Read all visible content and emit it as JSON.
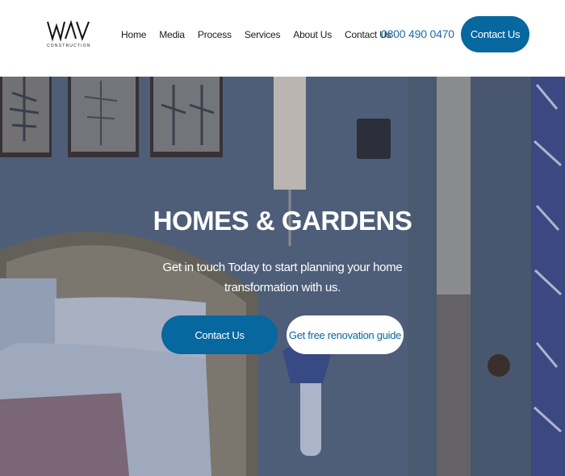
{
  "brand": {
    "logo_text": "WAV",
    "logo_subtext": "CONSTRUCTION"
  },
  "nav": {
    "items": [
      {
        "label": "Home"
      },
      {
        "label": "Media"
      },
      {
        "label": "Process"
      },
      {
        "label": "Services"
      },
      {
        "label": "About Us"
      },
      {
        "label": "Contact Us"
      }
    ]
  },
  "header": {
    "phone": "0800 490 0470",
    "cta_label": "Contact Us"
  },
  "hero": {
    "title": "HOMES & GARDENS",
    "subtitle": "Get in touch Today to start planning your home transformation with us.",
    "primary_button": "Contact Us",
    "secondary_button": "Get free renovation guide"
  },
  "colors": {
    "accent": "#07679f",
    "phone": "#1f6da0",
    "hero_overlay": "#55657d"
  }
}
